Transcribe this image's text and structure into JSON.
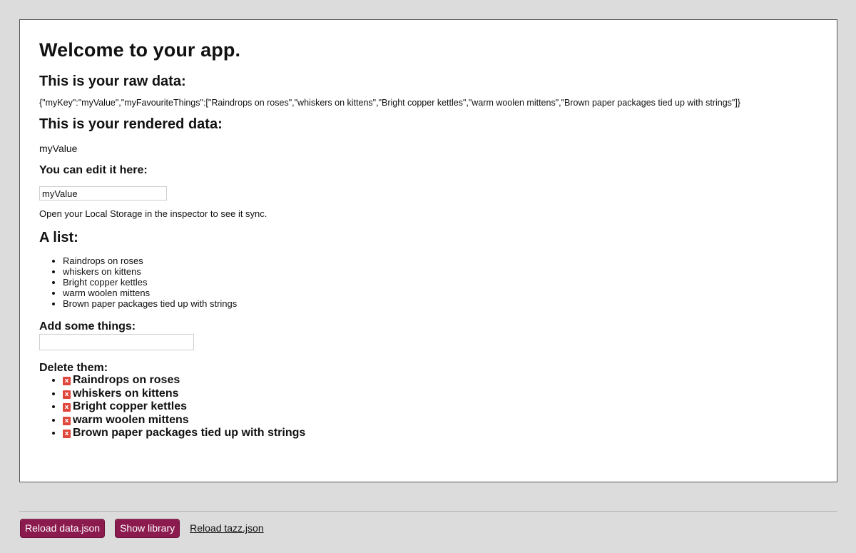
{
  "app": {
    "title": "Welcome to your app.",
    "raw_data_heading": "This is your raw data:",
    "raw_data": "{\"myKey\":\"myValue\",\"myFavouriteThings\":[\"Raindrops on roses\",\"whiskers on kittens\",\"Bright copper kettles\",\"warm woolen mittens\",\"Brown paper packages tied up with strings\"]}",
    "rendered_heading": "This is your rendered data:",
    "rendered_value": "myValue",
    "edit_heading": "You can edit it here:",
    "edit_value": "myValue",
    "storage_note": "Open your Local Storage in the inspector to see it sync.",
    "list_heading": "A list:",
    "list_items": [
      "Raindrops on roses",
      "whiskers on kittens",
      "Bright copper kettles",
      "warm woolen mittens",
      "Brown paper packages tied up with strings"
    ],
    "add_heading": "Add some things:",
    "add_value": "",
    "delete_heading": "Delete them:",
    "delete_icon_label": "x",
    "delete_icon": "close-icon",
    "delete_icon_color": "#e0473c",
    "delete_items": [
      "Raindrops on roses",
      "whiskers on kittens",
      "Bright copper kettles",
      "warm woolen mittens",
      "Brown paper packages tied up with strings"
    ]
  },
  "footer": {
    "reload_data_label": "Reload data.json",
    "show_library_label": "Show library",
    "reload_tazz_label": "Reload tazz.json",
    "button_color": "#8b1a4f"
  }
}
